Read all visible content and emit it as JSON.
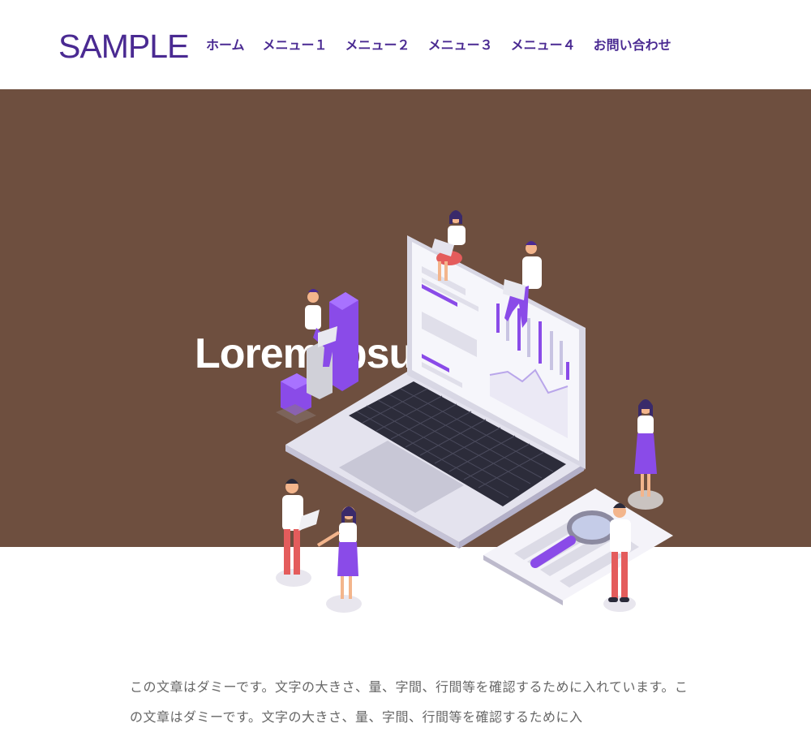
{
  "header": {
    "logo": "SAMPLE",
    "nav": [
      "ホーム",
      "メニュー１",
      "メニュー２",
      "メニュー３",
      "メニュー４",
      "お問い合わせ"
    ]
  },
  "hero": {
    "title": "Lorem ipsum",
    "illustration_icon": "laptop-analytics-illustration"
  },
  "content": {
    "paragraph": "この文章はダミーです。文字の大きさ、量、字間、行間等を確認するために入れています。この文章はダミーです。文字の大きさ、量、字間、行間等を確認するために入"
  },
  "colors": {
    "brand": "#4a2a92",
    "hero_bg": "#6e4f3f",
    "accent_purple": "#8a4be8",
    "text_gray": "#666666"
  }
}
